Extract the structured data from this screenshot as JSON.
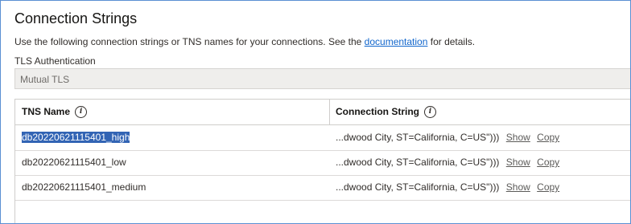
{
  "header": {
    "title": "Connection Strings",
    "description_prefix": "Use the following connection strings or TNS names for your connections. See the ",
    "description_link": "documentation",
    "description_suffix": " for details."
  },
  "tls": {
    "label": "TLS Authentication",
    "value": "Mutual TLS"
  },
  "table": {
    "columns": [
      "TNS Name",
      "Connection String"
    ],
    "rows": [
      {
        "name": "db20220621115401_high",
        "conn": "...dwood City, ST=California, C=US\")))",
        "show": "Show",
        "copy": "Copy"
      },
      {
        "name": "db20220621115401_low",
        "conn": "...dwood City, ST=California, C=US\")))",
        "show": "Show",
        "copy": "Copy"
      },
      {
        "name": "db20220621115401_medium",
        "conn": "...dwood City, ST=California, C=US\")))",
        "show": "Show",
        "copy": "Copy"
      }
    ]
  },
  "icons": {
    "info": "info-icon"
  },
  "colors": {
    "selection": "#3264b4",
    "link": "#1166cc",
    "border": "#5b8fd3"
  }
}
